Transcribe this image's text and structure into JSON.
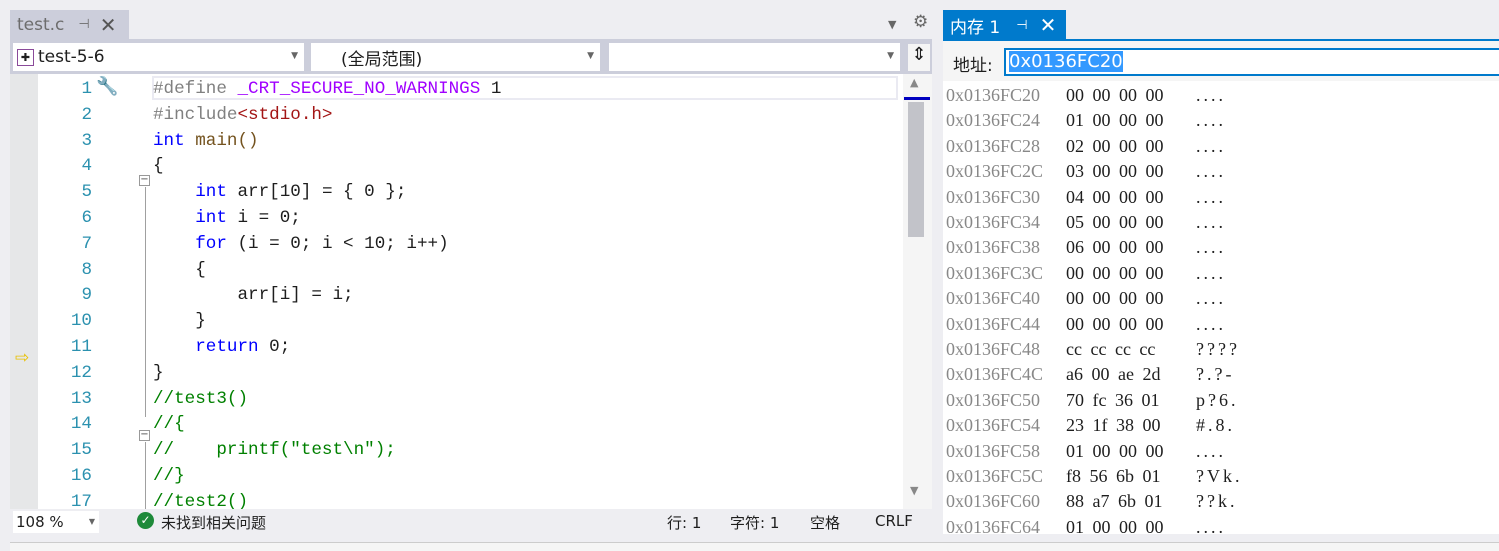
{
  "editor": {
    "tab": "test.c",
    "project": "test-5-6",
    "scope": "(全局范围)",
    "member": "",
    "zoom": "108 %",
    "issues": "未找到相关问题",
    "row": "行: 1",
    "col": "字符: 1",
    "spacing": "空格",
    "eol": "CRLF",
    "current_line": 10,
    "lines": [
      [
        [
          "#define ",
          "pp"
        ],
        [
          "_CRT_SECURE_NO_WARNINGS",
          "mac"
        ],
        [
          " 1",
          "num"
        ]
      ],
      [
        [
          "#include",
          "pp"
        ],
        [
          "<stdio.h>",
          "str"
        ]
      ],
      [
        [
          "int",
          "kw"
        ],
        [
          " main()",
          "fn"
        ]
      ],
      [
        [
          "{",
          "br"
        ]
      ],
      [
        [
          "    ",
          "id"
        ],
        [
          "int",
          "kw"
        ],
        [
          " arr[10] = { 0 };",
          "id"
        ]
      ],
      [
        [
          "    ",
          "id"
        ],
        [
          "int",
          "kw"
        ],
        [
          " i = 0;",
          "id"
        ]
      ],
      [
        [
          "    ",
          "id"
        ],
        [
          "for",
          "kw"
        ],
        [
          " (i = 0; i < 10; i++)",
          "id"
        ]
      ],
      [
        [
          "    {",
          "br"
        ]
      ],
      [
        [
          "        arr[i] = i;",
          "id"
        ]
      ],
      [
        [
          "    }",
          "br"
        ]
      ],
      [
        [
          "    ",
          "id"
        ],
        [
          "return",
          "kw"
        ],
        [
          " 0;",
          "id"
        ]
      ],
      [
        [
          "}",
          "br"
        ]
      ],
      [
        [
          "//test3()",
          "com"
        ]
      ],
      [
        [
          "//{",
          "com"
        ]
      ],
      [
        [
          "//    printf(\"test\\n\");",
          "com"
        ]
      ],
      [
        [
          "//}",
          "com"
        ]
      ],
      [
        [
          "//test2()",
          "com"
        ]
      ]
    ]
  },
  "memory": {
    "tab": "内存 1",
    "address_label": "地址:",
    "address": "0x0136FC20",
    "rows": [
      [
        "0x0136FC20",
        "00 00 00 00",
        "...."
      ],
      [
        "0x0136FC24",
        "01 00 00 00",
        "...."
      ],
      [
        "0x0136FC28",
        "02 00 00 00",
        "...."
      ],
      [
        "0x0136FC2C",
        "03 00 00 00",
        "...."
      ],
      [
        "0x0136FC30",
        "04 00 00 00",
        "...."
      ],
      [
        "0x0136FC34",
        "05 00 00 00",
        "...."
      ],
      [
        "0x0136FC38",
        "06 00 00 00",
        "...."
      ],
      [
        "0x0136FC3C",
        "00 00 00 00",
        "...."
      ],
      [
        "0x0136FC40",
        "00 00 00 00",
        "...."
      ],
      [
        "0x0136FC44",
        "00 00 00 00",
        "...."
      ],
      [
        "0x0136FC48",
        "cc cc cc cc",
        "????"
      ],
      [
        "0x0136FC4C",
        "a6 00 ae 2d",
        "?.?-"
      ],
      [
        "0x0136FC50",
        "70 fc 36 01",
        "p?6."
      ],
      [
        "0x0136FC54",
        "23 1f 38 00",
        "#.8."
      ],
      [
        "0x0136FC58",
        "01 00 00 00",
        "...."
      ],
      [
        "0x0136FC5C",
        "f8 56 6b 01",
        "?Vk."
      ],
      [
        "0x0136FC60",
        "88 a7 6b 01",
        "??k."
      ],
      [
        "0x0136FC64",
        "01 00 00 00",
        "...."
      ]
    ]
  },
  "colors": {
    "accent": "#007acc"
  }
}
